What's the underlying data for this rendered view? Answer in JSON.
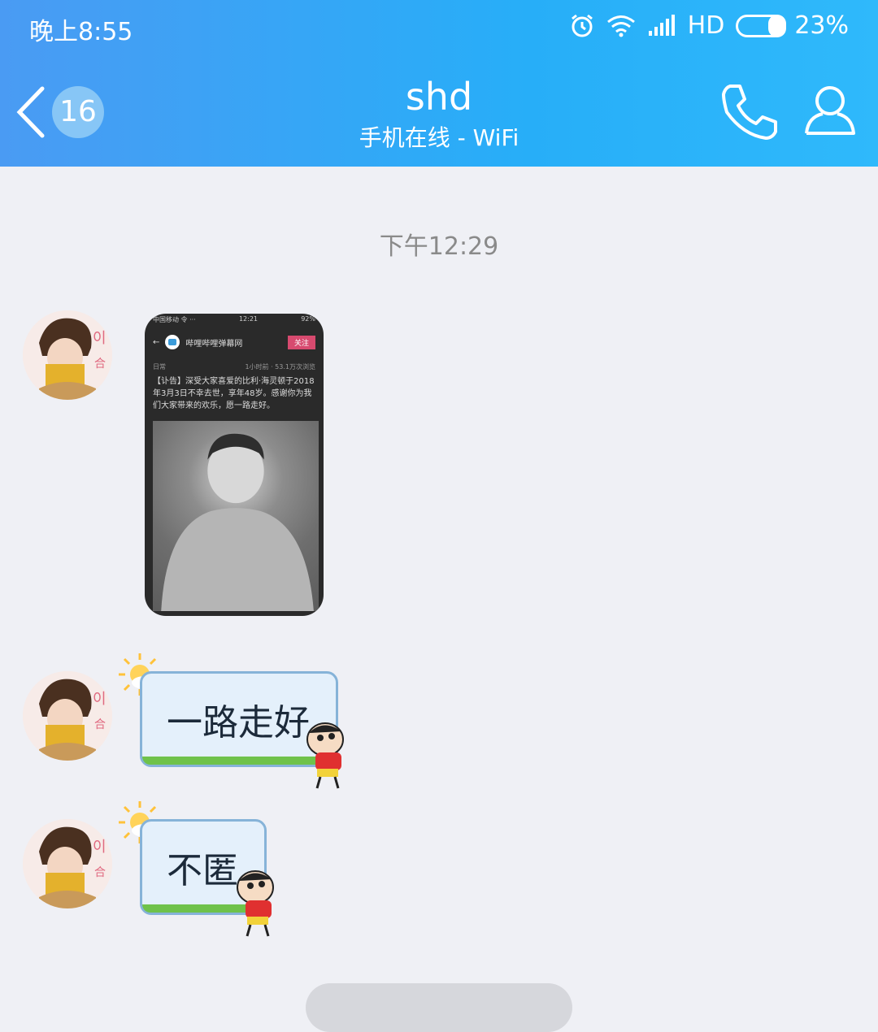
{
  "status_bar": {
    "time": "晚上8:55",
    "network": "HD",
    "battery": "23%",
    "icons": [
      "alarm-icon",
      "wifi-icon",
      "signal-icon",
      "battery-icon"
    ]
  },
  "header": {
    "back_count": "16",
    "title": "shd",
    "subtitle": "手机在线 - WiFi",
    "icons": [
      "back-chevron-icon",
      "phone-icon",
      "profile-icon"
    ],
    "colors": {
      "gradient_start": "#4a9bf3",
      "gradient_end": "#2fb9fb"
    }
  },
  "chat": {
    "timestamp": "下午12:29",
    "image_message": {
      "status_carrier": "中国移动 令 ···",
      "status_time": "12:21",
      "status_battery": "92%",
      "nav_title": "哔哩哔哩弹幕网",
      "follow_label": "关注",
      "meta_left": "日常",
      "meta_right": "1小时前 · 53.1万次浏览",
      "caption": "【讣告】深受大家喜爱的比利·海灵顿于2018年3月3日不幸去世，享年48岁。感谢你为我们大家带来的欢乐，愿一路走好。"
    },
    "messages": [
      {
        "text": "一路走好"
      },
      {
        "text": "不匿"
      }
    ]
  },
  "bottom": {
    "pill_label": ""
  },
  "colors": {
    "background": "#eff0f5",
    "bubble_bg": "#e4f0fb",
    "bubble_border": "#86b3d8",
    "bubble_grass": "#6fc24a"
  }
}
